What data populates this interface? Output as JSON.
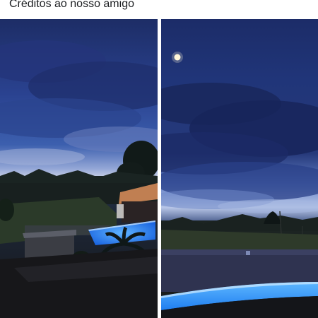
{
  "post": {
    "caption": "Créditos ao nosso amigo"
  },
  "photos": [
    {
      "name": "photo-left",
      "scene": "evening-sky-over-pool-house"
    },
    {
      "name": "photo-right",
      "scene": "moon-over-clouds-and-pool"
    }
  ],
  "colors": {
    "sky_deep": "#1b2a5e",
    "sky_mid": "#3a5aa8",
    "horizon_glow": "#c9d4ec",
    "pool_glow": "#2f8cff",
    "ground_dark": "#1a1a1d"
  }
}
